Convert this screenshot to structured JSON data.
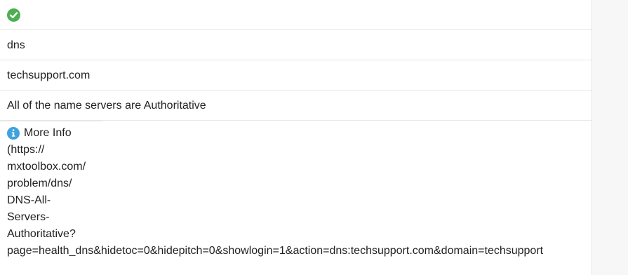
{
  "status": {
    "icon": "check-circle-icon",
    "color": "#4caf50"
  },
  "command": "dns",
  "domain": "techsupport.com",
  "result_message": "All of the name servers are Authoritative",
  "more_info": {
    "icon": "info-icon",
    "label": "More Info",
    "url_lines": [
      "(https://",
      "mxtoolbox.com/",
      "problem/dns/",
      "DNS-All-",
      "Servers-",
      "Authoritative?",
      "page=health_dns&hidetoc=0&hidepitch=0&showlogin=1&action=dns:techsupport.com&domain=techsupport"
    ]
  }
}
